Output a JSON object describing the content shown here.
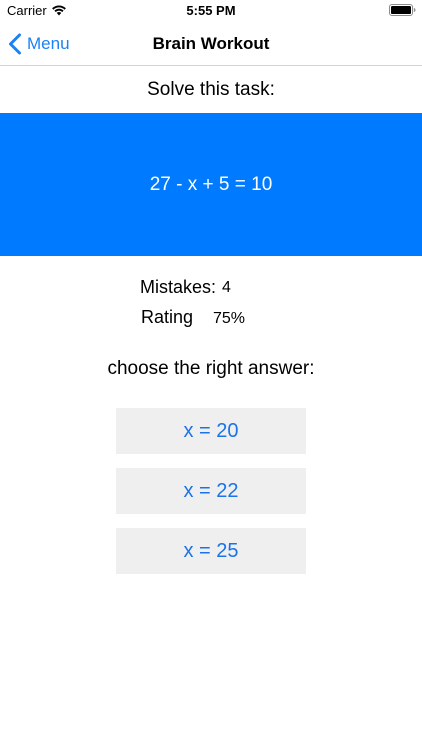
{
  "status_bar": {
    "carrier": "Carrier",
    "time": "5:55 PM",
    "icons": [
      "wifi-icon",
      "battery-icon"
    ]
  },
  "nav": {
    "back_label": "Menu",
    "back_icon": "chevron-left-icon",
    "title": "Brain Workout"
  },
  "task": {
    "prompt": "Solve this task:",
    "equation": "27 - x + 5 = 10"
  },
  "stats": {
    "mistakes_label": "Mistakes:",
    "mistakes_value": "4",
    "rating_label": "Rating",
    "rating_value": "75%"
  },
  "answers": {
    "prompt": "choose the right answer:",
    "options": [
      "x = 20",
      "x = 22",
      "x = 25"
    ]
  },
  "colors": {
    "accent": "#007aff",
    "button_background": "#efefef",
    "button_text": "#1a73e8"
  }
}
